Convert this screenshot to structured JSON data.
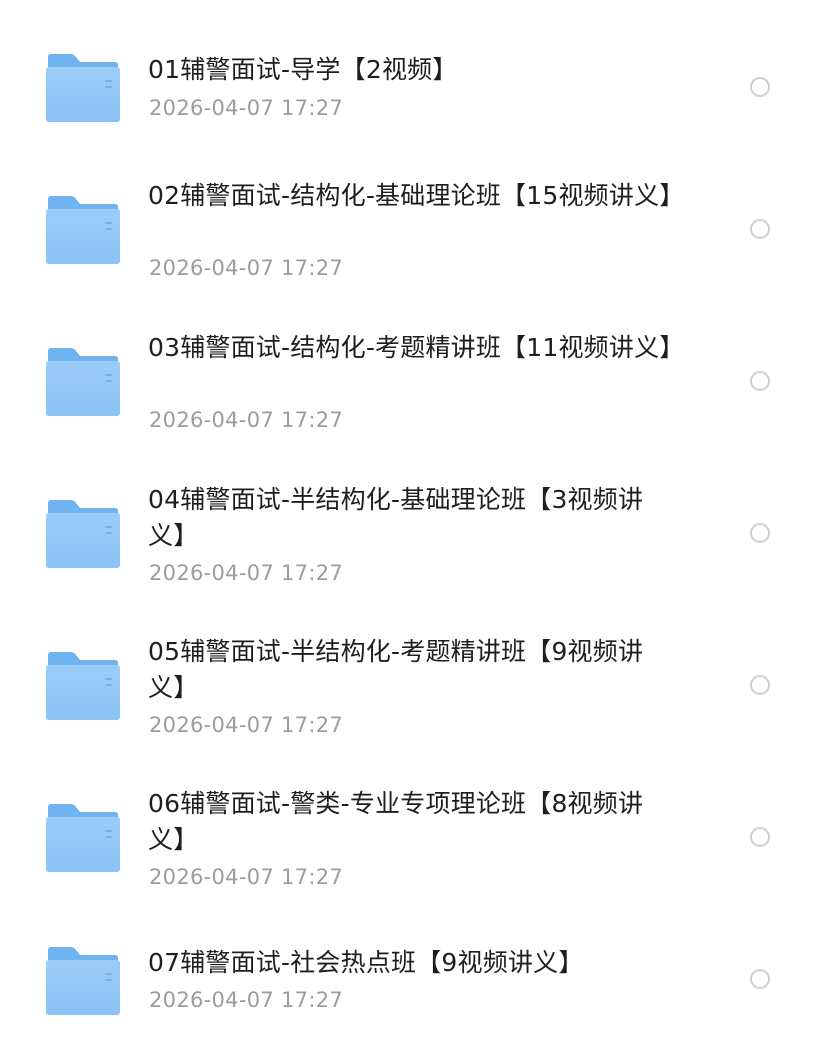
{
  "folder_icon": "folder-icon",
  "radio_icon": "radio-unchecked-icon",
  "colors": {
    "folder_light": "#9ccdf8",
    "folder_dark": "#6fb3f1",
    "title": "#1e1e1e",
    "date": "#9c9c9c",
    "radio_border": "#cfcfcf"
  },
  "items": [
    {
      "name": "01辅警面试-导学【2视频】",
      "date": "2026-04-07 17:27",
      "selected": false
    },
    {
      "name": "02辅警面试-结构化-基础理论班【15视频讲义】",
      "date": "2026-04-07 17:27",
      "selected": false
    },
    {
      "name": "03辅警面试-结构化-考题精讲班【11视频讲义】",
      "date": "2026-04-07 17:27",
      "selected": false
    },
    {
      "name": "04辅警面试-半结构化-基础理论班【3视频讲义】",
      "date": "2026-04-07 17:27",
      "selected": false
    },
    {
      "name": "05辅警面试-半结构化-考题精讲班【9视频讲义】",
      "date": "2026-04-07 17:27",
      "selected": false
    },
    {
      "name": "06辅警面试-警类-专业专项理论班【8视频讲义】",
      "date": "2026-04-07 17:27",
      "selected": false
    },
    {
      "name": "07辅警面试-社会热点班【9视频讲义】",
      "date": "2026-04-07 17:27",
      "selected": false
    }
  ]
}
